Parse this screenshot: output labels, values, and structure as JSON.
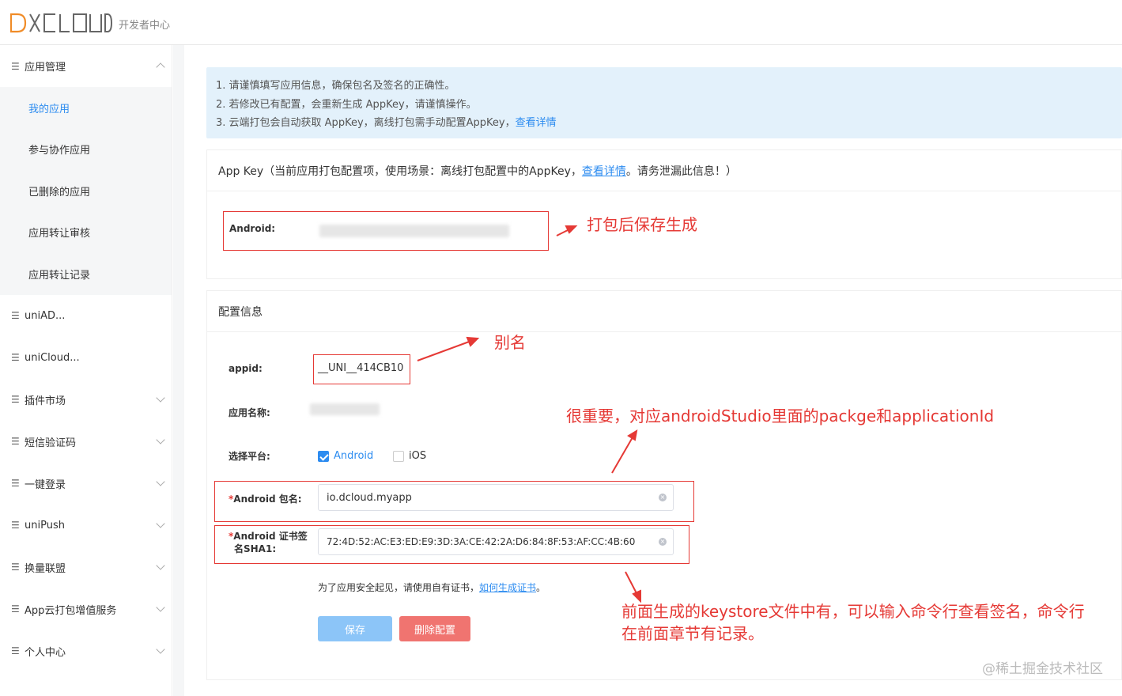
{
  "header": {
    "logo_text": "DCLOUD",
    "subtitle": "开发者中心"
  },
  "sidebar": {
    "groups": [
      {
        "label": "应用管理",
        "expanded": true
      },
      {
        "label": "uniAD..."
      },
      {
        "label": "uniCloud..."
      },
      {
        "label": "插件市场"
      },
      {
        "label": "短信验证码"
      },
      {
        "label": "一键登录"
      },
      {
        "label": "uniPush"
      },
      {
        "label": "换量联盟"
      },
      {
        "label": "App云打包增值服务"
      },
      {
        "label": "个人中心"
      }
    ],
    "app_items": [
      {
        "label": "我的应用",
        "active": true
      },
      {
        "label": "参与协作应用"
      },
      {
        "label": "已删除的应用"
      },
      {
        "label": "应用转让审核"
      },
      {
        "label": "应用转让记录"
      }
    ]
  },
  "notice": {
    "line1": "1. 请谨慎填写应用信息，确保包名及签名的正确性。",
    "line2": "2. 若修改已有配置，会重新生成 AppKey，请谨慎操作。",
    "line3": "3. 云端打包会自动获取 AppKey，离线打包需手动配置AppKey，",
    "line3_link": "查看详情"
  },
  "appkey": {
    "title_prefix": "App Key（当前应用打包配置项，使用场景：离线打包配置中的AppKey，",
    "title_link": "查看详情",
    "title_suffix": "。请务泄漏此信息！）",
    "android_label": "Android:"
  },
  "config": {
    "title": "配置信息",
    "appid_label": "appid:",
    "appid_value": "__UNI__414CB10",
    "app_name_label": "应用名称:",
    "platform_label": "选择平台:",
    "platform_android": "Android",
    "platform_ios": "iOS",
    "android_package_label": "Android 包名:",
    "android_package_value": "io.dcloud.myapp",
    "sha1_label_line1": "Android 证书签",
    "sha1_label_line2": "名SHA1:",
    "sha1_value": "72:4D:52:AC:E3:ED:E9:3D:3A:CE:42:2A:D6:84:8F:53:AF:CC:4B:60",
    "cert_hint": "为了应用安全起见，请使用自有证书，",
    "cert_link": "如何生成证书",
    "cert_hint_end": "。",
    "save_button": "保存",
    "delete_button": "删除配置"
  },
  "annotations": {
    "appkey_note": "打包后保存生成",
    "alias_note": "别名",
    "package_note": "很重要，对应androidStudio里面的packge和applicationId",
    "sha1_note_line1": "前面生成的keystore文件中有，可以输入命令行查看签名，命令行",
    "sha1_note_line2": "在前面章节有记录。"
  },
  "watermark": "@稀土掘金技术社区",
  "colors": {
    "accent": "#2d8cf0",
    "annotation_red": "#e53935",
    "notice_bg": "#e3f1fb",
    "save_bg": "#8cc5f8",
    "delete_bg": "#f07470"
  }
}
